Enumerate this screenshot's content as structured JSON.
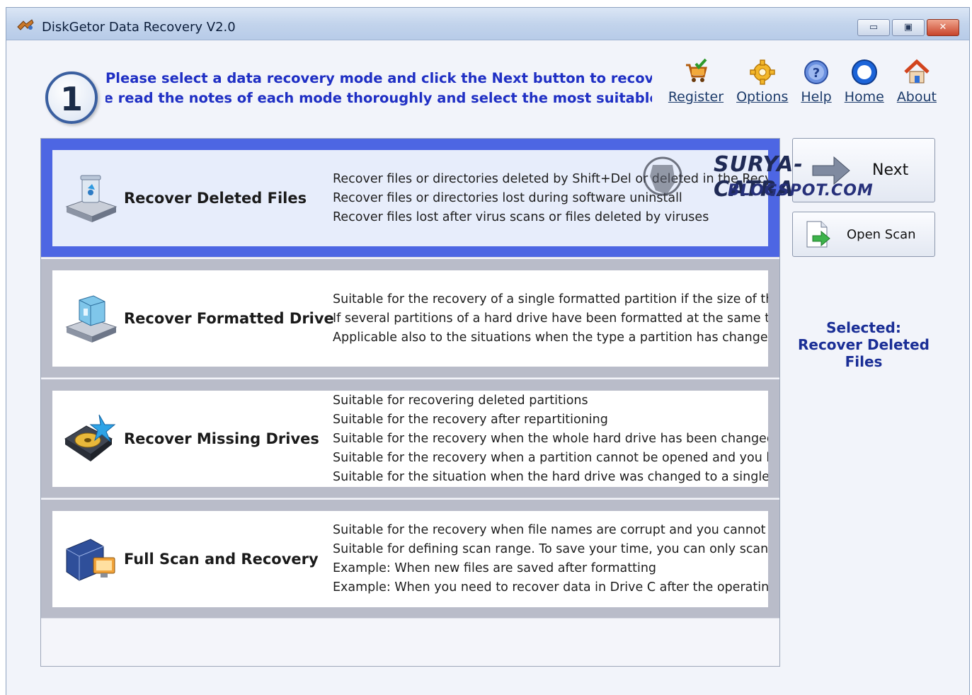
{
  "window": {
    "title": "DiskGetor Data Recovery V2.0",
    "controls": {
      "minimize": "▭",
      "maximize": "▣",
      "close": "✕"
    }
  },
  "header": {
    "step_number": "1",
    "prompt_line1": "Please select a data recovery mode and click the Next button to recover.",
    "prompt_line2": "se read the notes of each mode thoroughly and select the most suitable ("
  },
  "toolbar": {
    "items": [
      {
        "label": "Register",
        "icon": "cart-check-icon"
      },
      {
        "label": "Options",
        "icon": "gear-icon"
      },
      {
        "label": "Help",
        "icon": "help-icon"
      },
      {
        "label": "Home",
        "icon": "home-globe-icon"
      },
      {
        "label": "About",
        "icon": "house-icon"
      }
    ]
  },
  "modes": [
    {
      "title": "Recover Deleted Files",
      "icon": "recycle-bin-drive-icon",
      "selected": true,
      "lines": [
        "Recover files or directories deleted by Shift+Del or deleted in the Recycle B",
        "Recover files or directories lost during software uninstall",
        "Recover files lost after virus scans or files deleted by viruses"
      ]
    },
    {
      "title": "Recover Formatted Drive",
      "icon": "formatted-drive-icon",
      "selected": false,
      "lines": [
        "Suitable for the recovery of a single formatted partition if the size of the pa",
        "If several partitions of a hard drive have been formatted at the same time,",
        "Applicable also to the situations when the type a partition has changed, su"
      ]
    },
    {
      "title": "Recover Missing Drives",
      "icon": "missing-drive-icon",
      "selected": false,
      "lines": [
        "Suitable for recovering deleted partitions",
        "Suitable for the recovery after repartitioning",
        "Suitable for the recovery when the whole hard drive has been changed to a",
        "Suitable for the recovery when a partition cannot be opened and you have",
        "Suitable for the situation when the hard drive was changed to a single part"
      ]
    },
    {
      "title": "Full Scan and Recovery",
      "icon": "full-scan-icon",
      "selected": false,
      "lines": [
        "Suitable for the recovery when file names are corrupt and you cannot reco",
        "Suitable for defining scan range. To save your time, you can only scan cert",
        "Example: When new files are saved after formatting",
        "Example: When you need to recover data in Drive C after the operating sy"
      ]
    }
  ],
  "side": {
    "next_label": "Next",
    "open_scan_label": "Open Scan",
    "selected_heading": "Selected:",
    "selected_value": "Recover Deleted Files"
  },
  "watermark": {
    "line1": "SURYA-CATRA",
    "line2": "BLOGSPOT.COM"
  },
  "colors": {
    "selected_border": "#4d66e3",
    "unselected_border": "#b9bcc9",
    "prompt_text": "#1f2fc4",
    "selected_info": "#1a2e96"
  }
}
